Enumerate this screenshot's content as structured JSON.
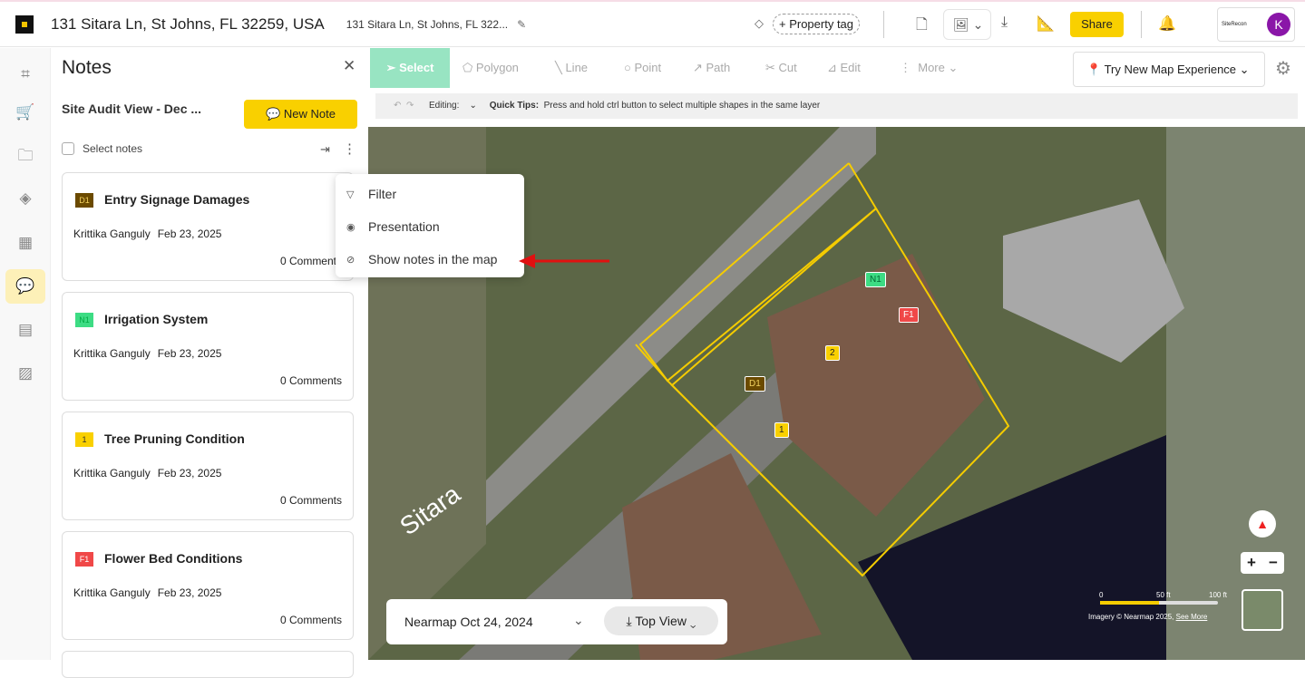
{
  "header": {
    "title": "131 Sitara Ln, St Johns, FL 32259, USA",
    "subtitle": "131 Sitara Ln, St Johns, FL 322...",
    "property_tag": "+ Property tag",
    "share": "Share",
    "brand": "SiteRecon",
    "avatar": "K"
  },
  "notes": {
    "title": "Notes",
    "view": "Site Audit View - Dec ...",
    "new_note": "New Note",
    "select_notes": "Select notes",
    "items": [
      {
        "badge": "D1",
        "badge_color": "#6b4a00",
        "badge_text": "#f0d060",
        "title": "Entry Signage Damages",
        "author": "Krittika Ganguly",
        "date": "Feb 23, 2025",
        "comments": "0 Comments"
      },
      {
        "badge": "N1",
        "badge_color": "#3ddc84",
        "badge_text": "#0a4",
        "title": "Irrigation System",
        "author": "Krittika Ganguly",
        "date": "Feb 23, 2025",
        "comments": "0 Comments"
      },
      {
        "badge": "1",
        "badge_color": "#f9d000",
        "badge_text": "#333",
        "title": "Tree Pruning Condition",
        "author": "Krittika Ganguly",
        "date": "Feb 23, 2025",
        "comments": "0 Comments"
      },
      {
        "badge": "F1",
        "badge_color": "#f04848",
        "badge_text": "#fff",
        "title": "Flower Bed Conditions",
        "author": "Krittika Ganguly",
        "date": "Feb 23, 2025",
        "comments": "0 Comments"
      }
    ]
  },
  "menu": {
    "items": [
      "Filter",
      "Presentation",
      "Show notes in the map"
    ]
  },
  "toolbar": {
    "tools": [
      "Select",
      "Polygon",
      "Line",
      "Point",
      "Path",
      "Cut",
      "Edit",
      "More"
    ],
    "try_new": "Try New Map Experience",
    "editing": "Editing:",
    "tips_label": "Quick Tips:",
    "tips": "Press and hold ctrl button to select multiple shapes in the same layer"
  },
  "map": {
    "imagery_date": "Nearmap Oct 24, 2024",
    "view": "Top View",
    "scale": [
      "0",
      "50 ft",
      "100 ft"
    ],
    "attribution": "Imagery © Nearmap 2025,",
    "see_more": "See More",
    "street": "Sitara",
    "markers": [
      "N1",
      "F1",
      "2",
      "D1",
      "1"
    ]
  }
}
